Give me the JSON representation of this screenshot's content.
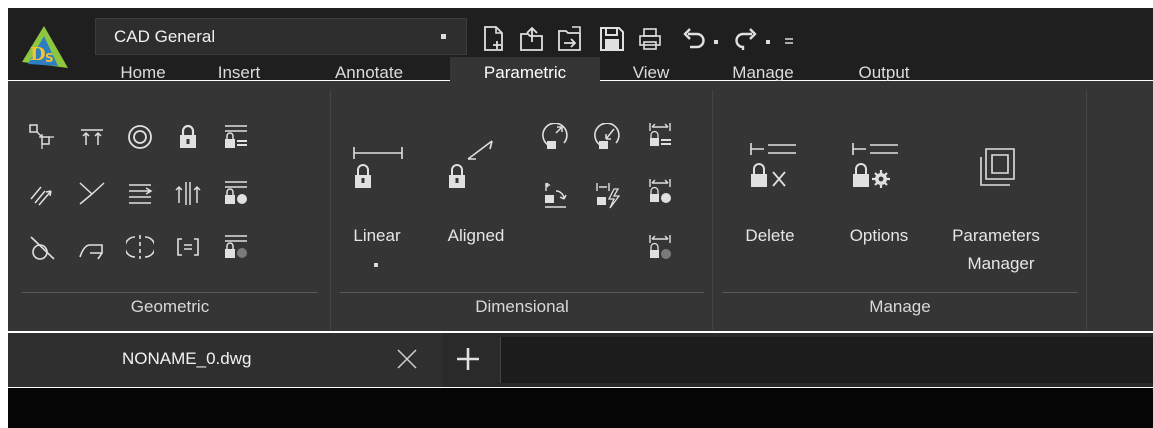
{
  "workspace": {
    "label": "CAD General"
  },
  "quick_access": [
    "new-file-icon",
    "open-file-icon",
    "export-file-icon",
    "save-icon",
    "print-icon",
    "undo-icon",
    "redo-icon",
    "customize-icon"
  ],
  "tabs": [
    {
      "label": "Home"
    },
    {
      "label": "Insert"
    },
    {
      "label": "Annotate"
    },
    {
      "label": "Parametric",
      "active": true
    },
    {
      "label": "View"
    },
    {
      "label": "Manage"
    },
    {
      "label": "Output"
    }
  ],
  "panels": {
    "geometric": {
      "title": "Geometric"
    },
    "dimensional": {
      "title": "Dimensional",
      "linear": "Linear",
      "aligned": "Aligned"
    },
    "manage": {
      "title": "Manage",
      "delete": "Delete",
      "options": "Options",
      "parameters": "Parameters",
      "manager": "Manager"
    }
  },
  "document": {
    "tab_name": "NONAME_0.dwg"
  },
  "colors": {
    "background": "#353535",
    "titlebar": "#1f1f1f",
    "text": "#e6e6e6",
    "logo_green": "#8dc63f",
    "logo_blue": "#2d7ec3"
  }
}
